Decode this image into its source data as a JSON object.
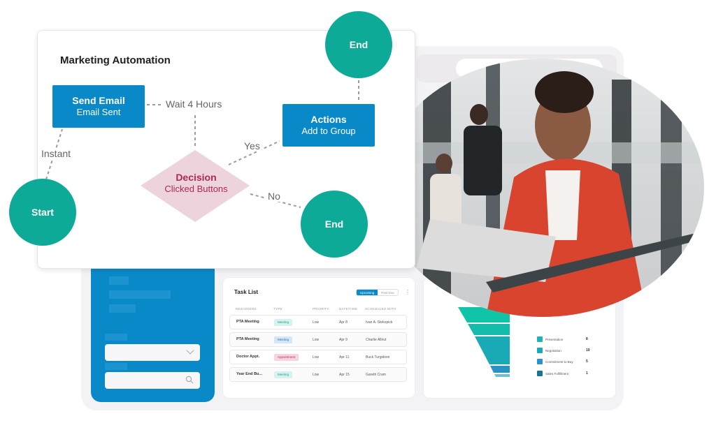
{
  "automation": {
    "title": "Marketing Automation",
    "nodes": {
      "send_email": {
        "title": "Send Email",
        "subtitle": "Email Sent"
      },
      "actions": {
        "title": "Actions",
        "subtitle": "Add to Group"
      },
      "decision": {
        "title": "Decision",
        "subtitle": "Clicked Buttons"
      },
      "start": {
        "label": "Start"
      },
      "end_top": {
        "label": "End"
      },
      "end_bottom": {
        "label": "End"
      }
    },
    "edges": {
      "instant": "Instant",
      "wait": "Wait 4 Hours",
      "yes": "Yes",
      "no": "No"
    }
  },
  "task_list": {
    "title": "Task List",
    "tabs": {
      "upcoming": "Upcoming",
      "past_due": "Past Due"
    },
    "active_tab": "Upcoming",
    "columns": [
      "REGARDING",
      "TYPE",
      "PRIORITY",
      "DATE/TIME",
      "SCHEDULED WITH"
    ],
    "rows": [
      {
        "regarding": "PTA Meeting",
        "type": "Meeting",
        "priority": "Low",
        "date": "Apr 8",
        "with": "Ivan A. Stekopick"
      },
      {
        "regarding": "PTA Meeting",
        "type": "Meeting",
        "priority": "Low",
        "date": "Apr 9",
        "with": "Charlie Allnut"
      },
      {
        "regarding": "Doctor Appt.",
        "type": "Appointment",
        "priority": "Low",
        "date": "Apr 11",
        "with": "Buck Turgidson"
      },
      {
        "regarding": "Year End Bu...",
        "type": "Meeting",
        "priority": "Low",
        "date": "Apr 15",
        "with": "Gareth Cram"
      }
    ]
  },
  "funnel": {
    "legend": [
      {
        "label": "Presentation",
        "value": "8",
        "color": "#1fb3b5"
      },
      {
        "label": "Negotiation",
        "value": "19",
        "color": "#1aa9b9"
      },
      {
        "label": "Commitment to Buy",
        "value": "5",
        "color": "#2a93c6"
      },
      {
        "label": "Sales Fulfillment",
        "value": "1",
        "color": "#1a7495"
      }
    ]
  },
  "colors": {
    "primary_blue": "#0a89c8",
    "teal": "#0daa98",
    "decision_pink": "#ecd3dc",
    "decision_text": "#b0294e",
    "meeting_teal_bg": "#d6f2ee",
    "meeting_teal_fg": "#1ea192",
    "meeting_blue_bg": "#d4e6f7",
    "meeting_blue_fg": "#2f6fb3",
    "appointment_bg": "#f6d6de",
    "appointment_fg": "#c2294f"
  }
}
